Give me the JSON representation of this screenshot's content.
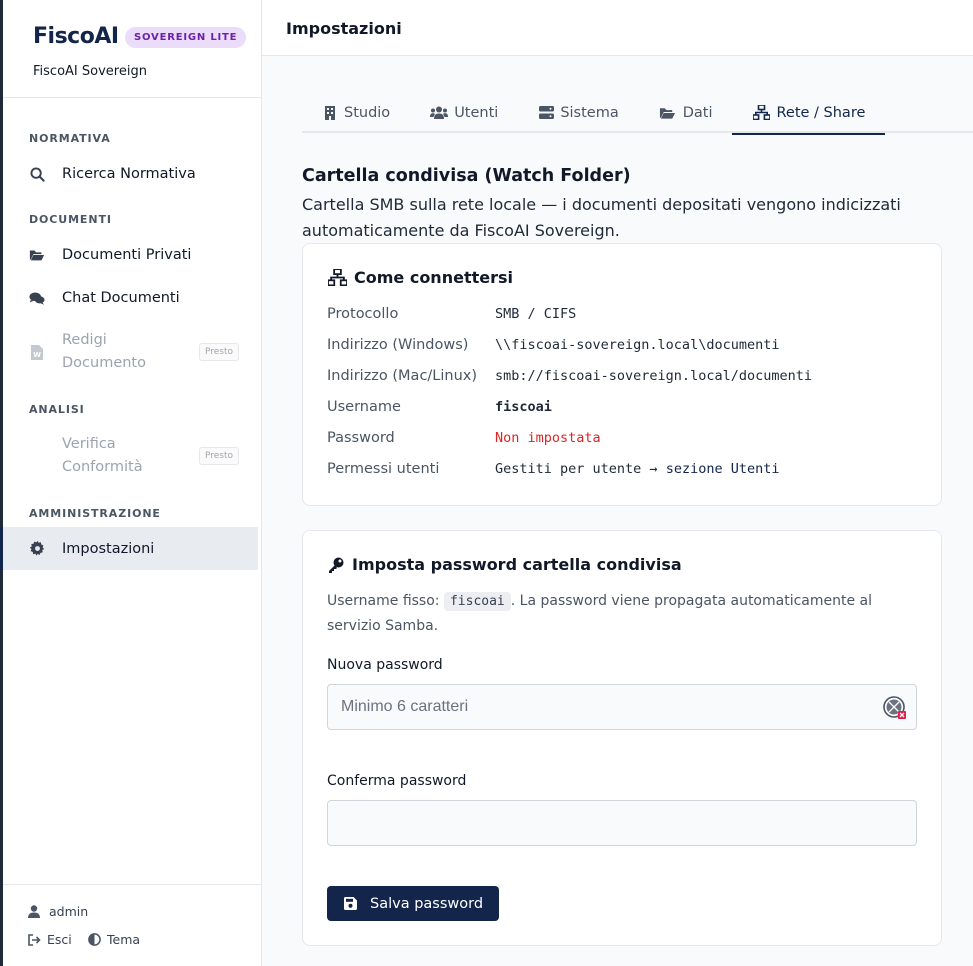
{
  "brand": {
    "logo": "FiscoAI",
    "badge": "SOVEREIGN LITE",
    "subtitle": "FiscoAI Sovereign"
  },
  "sidebar": {
    "sections": [
      {
        "label": "NORMATIVA"
      },
      {
        "label": "DOCUMENTI"
      },
      {
        "label": "ANALISI"
      },
      {
        "label": "AMMINISTRAZIONE"
      }
    ],
    "items": [
      {
        "label": "Ricerca Normativa",
        "icon": "search-icon"
      },
      {
        "label": "Documenti Privati",
        "icon": "folder-open-icon"
      },
      {
        "label": "Chat Documenti",
        "icon": "comments-icon"
      },
      {
        "label_1": "Redigi",
        "label_2": "Documento",
        "icon": "word-file-icon",
        "badge": "Presto"
      },
      {
        "label_1": "Verifica",
        "label_2": "Conformità",
        "badge": "Presto"
      },
      {
        "label": "Impostazioni",
        "icon": "gear-icon"
      }
    ],
    "footer": {
      "user": "admin",
      "logout": "Esci",
      "theme": "Tema"
    }
  },
  "header": {
    "title": "Impostazioni"
  },
  "tabs": [
    {
      "label": "Studio",
      "icon": "building-icon"
    },
    {
      "label": "Utenti",
      "icon": "users-icon"
    },
    {
      "label": "Sistema",
      "icon": "server-icon"
    },
    {
      "label": "Dati",
      "icon": "folder-open-icon"
    },
    {
      "label": "Rete / Share",
      "icon": "network-icon",
      "active": true
    }
  ],
  "section": {
    "title": "Cartella condivisa (Watch Folder)",
    "description": "Cartella SMB sulla rete locale — i documenti depositati vengono indicizzati automaticamente da FiscoAI Sovereign."
  },
  "connect_card": {
    "title": "Come connettersi",
    "rows": [
      {
        "key": "Protocollo",
        "value": "SMB / CIFS"
      },
      {
        "key": "Indirizzo (Windows)",
        "value": "\\\\fiscoai-sovereign.local\\documenti"
      },
      {
        "key": "Indirizzo (Mac/Linux)",
        "value": "smb://fiscoai-sovereign.local/documenti"
      },
      {
        "key": "Username",
        "value": "fiscoai"
      },
      {
        "key": "Password",
        "value": "Non impostata"
      },
      {
        "key": "Permessi utenti",
        "value_prefix": "Gestiti per utente → ",
        "value_link": "sezione Utenti"
      }
    ]
  },
  "password_card": {
    "title": "Imposta password cartella condivisa",
    "note_prefix": "Username fisso: ",
    "note_code": "fiscoai",
    "note_suffix": ". La password viene propagata automaticamente al servizio Samba.",
    "new_label": "Nuova password",
    "new_placeholder": "Minimo 6 caratteri",
    "confirm_label": "Conferma password",
    "confirm_placeholder": "",
    "save_label": "Salva password"
  },
  "colors": {
    "primary": "#13254a",
    "badge_bg": "#ebdcfa",
    "badge_text": "#6b21a8",
    "error": "#dc2626"
  }
}
